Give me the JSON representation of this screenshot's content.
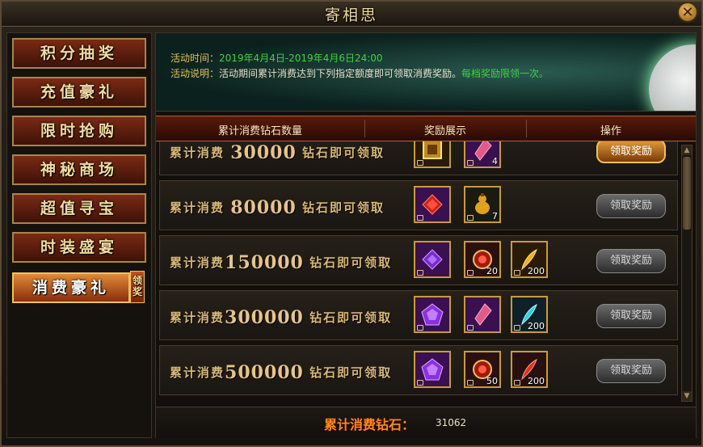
{
  "window": {
    "title": "寄相思",
    "close_icon": "close-icon"
  },
  "sidebar": {
    "items": [
      {
        "label": "积分抽奖"
      },
      {
        "label": "充值豪礼"
      },
      {
        "label": "限时抢购"
      },
      {
        "label": "神秘商场"
      },
      {
        "label": "超值寻宝"
      },
      {
        "label": "时装盛宴"
      },
      {
        "label": "消费豪礼",
        "badge": "领奖",
        "active": true
      }
    ]
  },
  "info": {
    "time_label": "活动时间：",
    "time_value": "2019年4月4日-2019年4月6日24:00",
    "desc_label": "活动说明：",
    "desc_value": "活动期间累计消费达到下列指定额度即可领取消费奖励。",
    "desc_extra": "每档奖励限领一次。"
  },
  "table": {
    "headers": [
      "累计消费钻石数量",
      "奖励展示",
      "操作"
    ],
    "rows": [
      {
        "prefix": "累计消费",
        "amount": "30000",
        "suffix": "钻石即可领取",
        "items": [
          {
            "type": "gold-frame",
            "count": ""
          },
          {
            "type": "crystal-pink",
            "count": "4"
          }
        ],
        "button": "领取奖励",
        "active": true
      },
      {
        "prefix": "累计消费",
        "amount": "80000",
        "suffix": "钻石即可领取",
        "items": [
          {
            "type": "gem-red",
            "count": ""
          },
          {
            "type": "gourd",
            "count": "7"
          }
        ],
        "button": "领取奖励",
        "active": false
      },
      {
        "prefix": "累计消费",
        "amount": "150000",
        "suffix": "钻石即可领取",
        "items": [
          {
            "type": "gem-purple",
            "count": ""
          },
          {
            "type": "medal-red",
            "count": "20"
          },
          {
            "type": "feather-gold",
            "count": "200"
          }
        ],
        "button": "领取奖励",
        "active": false
      },
      {
        "prefix": "累计消费",
        "amount": "300000",
        "suffix": "钻石即可领取",
        "items": [
          {
            "type": "gem-purple-large",
            "count": ""
          },
          {
            "type": "crystal-pink",
            "count": ""
          },
          {
            "type": "feather-cyan",
            "count": "200"
          }
        ],
        "button": "领取奖励",
        "active": false
      },
      {
        "prefix": "累计消费",
        "amount": "500000",
        "suffix": "钻石即可领取",
        "items": [
          {
            "type": "gem-purple-large",
            "count": ""
          },
          {
            "type": "medal-red",
            "count": "50"
          },
          {
            "type": "feather-red",
            "count": "200"
          }
        ],
        "button": "领取奖励",
        "active": false
      }
    ]
  },
  "footer": {
    "label": "累计消费钻石：",
    "value": "31062"
  },
  "colors": {
    "accent": "#f0c060",
    "highlight": "#ff8a1a",
    "green": "#3fd23f"
  }
}
